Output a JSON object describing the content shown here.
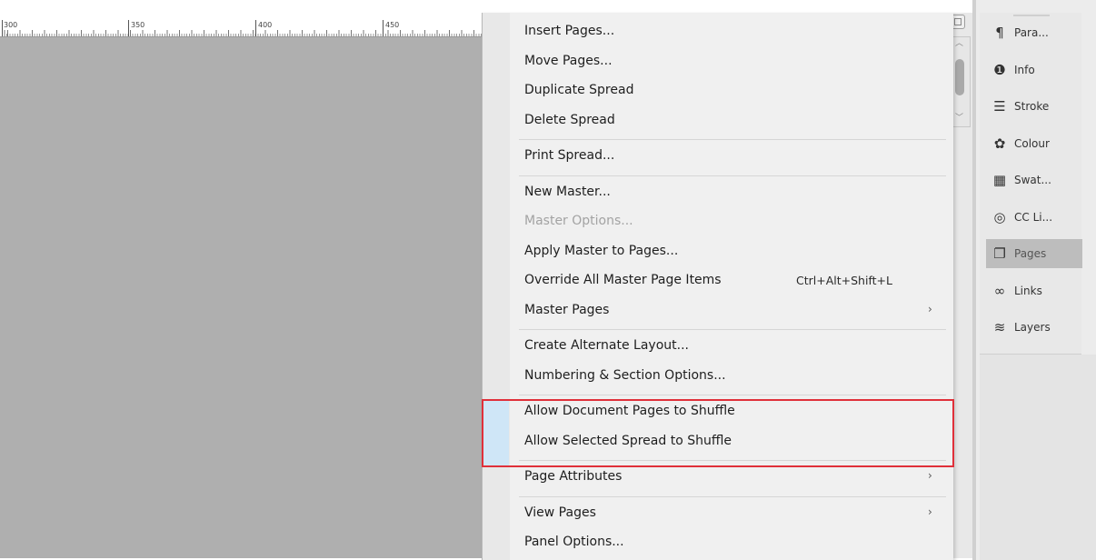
{
  "ruler": {
    "labels": [
      "300",
      "350",
      "400",
      "450"
    ]
  },
  "flyout_menu": {
    "groups": [
      [
        {
          "label": "Insert Pages...",
          "enabled": true
        },
        {
          "label": "Move Pages...",
          "enabled": true
        },
        {
          "label": "Duplicate Spread",
          "enabled": true
        },
        {
          "label": "Delete Spread",
          "enabled": true
        }
      ],
      [
        {
          "label": "Print Spread...",
          "enabled": true
        }
      ],
      [
        {
          "label": "New Master...",
          "enabled": true
        },
        {
          "label": "Master Options...",
          "enabled": false
        },
        {
          "label": "Apply Master to Pages...",
          "enabled": true
        },
        {
          "label": "Override All Master Page Items",
          "shortcut": "Ctrl+Alt+Shift+L",
          "enabled": true
        },
        {
          "label": "Master Pages",
          "submenu": true,
          "enabled": true
        }
      ],
      [
        {
          "label": "Create Alternate Layout...",
          "enabled": true
        },
        {
          "label": "Numbering & Section Options...",
          "enabled": true
        }
      ],
      [
        {
          "label": "Allow Document Pages to Shuffle",
          "checked": true,
          "enabled": true
        },
        {
          "label": "Allow Selected Spread to Shuffle",
          "checked": true,
          "enabled": true
        }
      ],
      [
        {
          "label": "Page Attributes",
          "submenu": true,
          "enabled": true
        }
      ],
      [
        {
          "label": "View Pages",
          "submenu": true,
          "enabled": true
        },
        {
          "label": "Panel Options...",
          "enabled": true
        }
      ]
    ],
    "submenu_arrow": "›",
    "check_mark": "✓",
    "highlight_color": "#e0303a"
  },
  "dock": {
    "items": [
      {
        "label": "Para...",
        "icon": "paragraph-icon",
        "glyph": "¶",
        "active": false
      },
      {
        "label": "Info",
        "icon": "info-icon",
        "glyph": "❶",
        "active": false
      },
      {
        "label": "Stroke",
        "icon": "stroke-icon",
        "glyph": "☰",
        "active": false
      },
      {
        "label": "Colour",
        "icon": "colour-icon",
        "glyph": "✿",
        "active": false
      },
      {
        "label": "Swat...",
        "icon": "swatches-icon",
        "glyph": "▦",
        "active": false
      },
      {
        "label": "CC Li...",
        "icon": "cc-libraries-icon",
        "glyph": "◎",
        "active": false
      },
      {
        "label": "Pages",
        "icon": "pages-icon",
        "glyph": "❐",
        "active": true
      },
      {
        "label": "Links",
        "icon": "links-icon",
        "glyph": "∞",
        "active": false
      },
      {
        "label": "Layers",
        "icon": "layers-icon",
        "glyph": "≋",
        "active": false
      }
    ]
  }
}
